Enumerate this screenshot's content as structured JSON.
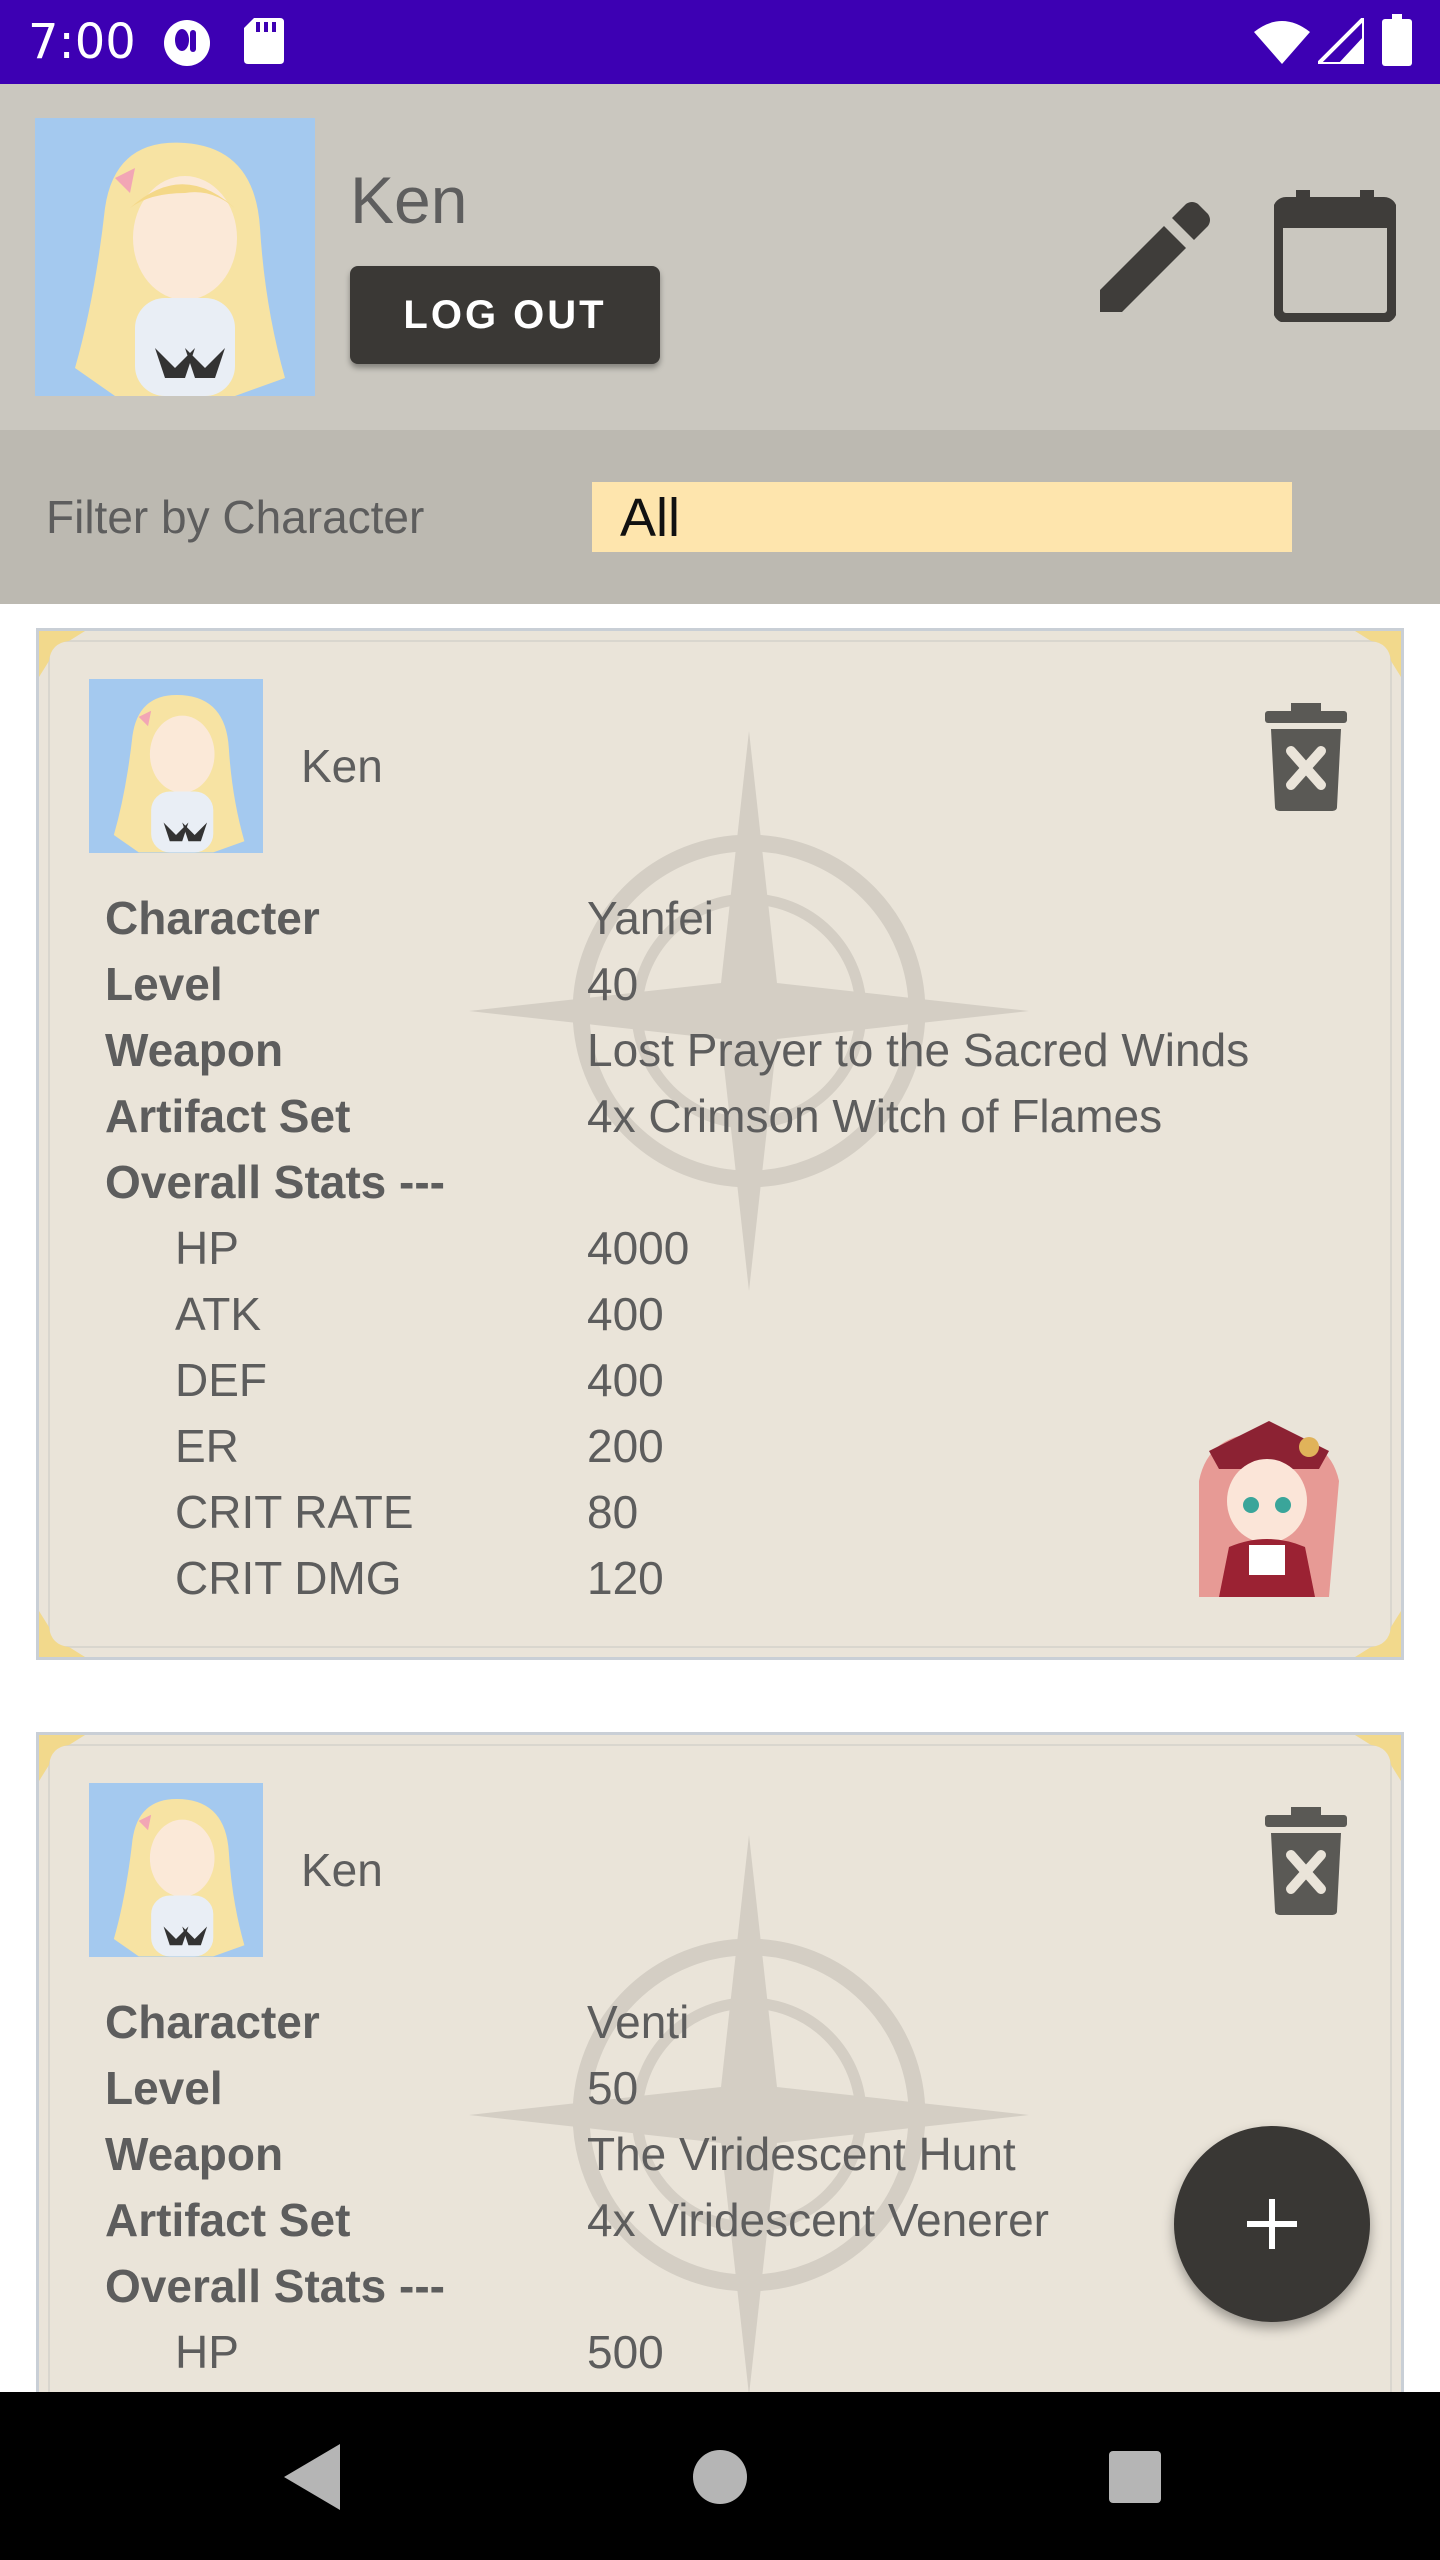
{
  "status_bar": {
    "time": "7:00",
    "icons": [
      "profile-circle-icon",
      "sd-card-icon",
      "wifi-icon",
      "cell-signal-icon",
      "battery-icon"
    ]
  },
  "profile": {
    "username": "Ken",
    "logout_label": "LOG OUT",
    "edit_icon": "pencil-icon",
    "calendar_icon": "calendar-icon"
  },
  "filter": {
    "label": "Filter by Character",
    "selected": "All"
  },
  "cards": [
    {
      "user": "Ken",
      "rows": [
        {
          "label": "Character",
          "value": "Yanfei"
        },
        {
          "label": "Level",
          "value": "40"
        },
        {
          "label": "Weapon",
          "value": "Lost Prayer to the Sacred Winds"
        },
        {
          "label": "Artifact Set",
          "value": "4x Crimson Witch of Flames"
        },
        {
          "label": "Overall Stats ---",
          "value": ""
        }
      ],
      "stats": [
        {
          "label": "HP",
          "value": "4000"
        },
        {
          "label": "ATK",
          "value": "400"
        },
        {
          "label": "DEF",
          "value": "400"
        },
        {
          "label": "ER",
          "value": "200"
        },
        {
          "label": "CRIT RATE",
          "value": "80"
        },
        {
          "label": "CRIT DMG",
          "value": "120"
        }
      ]
    },
    {
      "user": "Ken",
      "rows": [
        {
          "label": "Character",
          "value": "Venti"
        },
        {
          "label": "Level",
          "value": "50"
        },
        {
          "label": "Weapon",
          "value": "The Viridescent Hunt"
        },
        {
          "label": "Artifact Set",
          "value": "4x Viridescent Venerer"
        },
        {
          "label": "Overall Stats ---",
          "value": ""
        }
      ],
      "stats": [
        {
          "label": "HP",
          "value": "500"
        }
      ]
    }
  ],
  "fab_icon": "plus-icon",
  "nav": [
    "back-icon",
    "home-icon",
    "recents-icon"
  ],
  "colors": {
    "status_bar": "#3d00b3",
    "header_bg": "#cac7bf",
    "filter_bg": "#bcb9b1",
    "filter_select_bg": "#fee5ad",
    "card_bg": "#eae4d9",
    "button_dark": "#3a3835"
  }
}
